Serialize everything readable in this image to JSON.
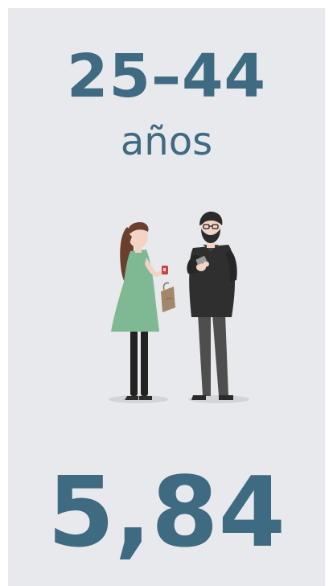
{
  "card": {
    "age_range": "25–44",
    "age_unit": "años",
    "value": "5,84"
  },
  "colors": {
    "accent": "#3e6a82",
    "background": "#e8e9ec",
    "woman_dress": "#7fb994",
    "woman_hair": "#6b3f2e",
    "man_jacket": "#2f2f2f",
    "man_pants": "#4e4e4e",
    "phone_case": "#c94343",
    "bag": "#a3876a"
  },
  "illustration": {
    "icon": "two-people-talking-illustration"
  }
}
